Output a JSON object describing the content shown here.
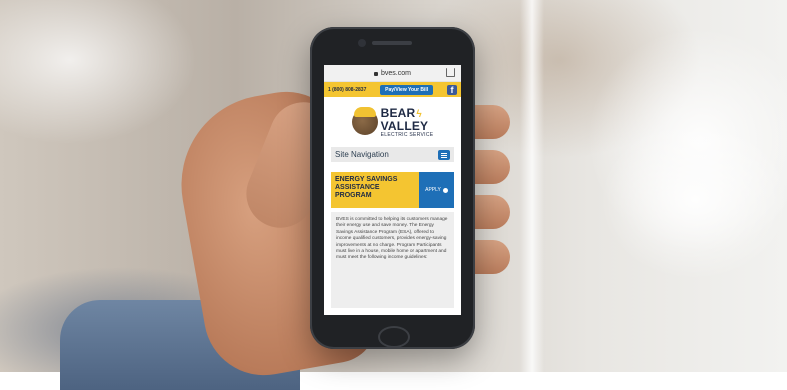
{
  "browser": {
    "url": "bves.com",
    "icons": [
      "lock-icon",
      "share-icon"
    ]
  },
  "topbar": {
    "phone": "1 (800) 808-2837",
    "pay_button": "Pay/View Your Bill",
    "facebook_icon": "f"
  },
  "logo": {
    "line1": "BEAR",
    "line2": "VALLEY",
    "line3": "ELECTRIC SERVICE"
  },
  "navigation": {
    "label": "Site Navigation",
    "menu_icon": "menu-icon"
  },
  "hero": {
    "title": "ENERGY SAVINGS ASSISTANCE PROGRAM",
    "apply": "APPLY"
  },
  "content": {
    "paragraph": "BVES is committed to helping its customers manage their energy use and save money. The Energy Savings Assistance Program (ESA), offered to income qualified customers, provides energy-saving improvements at no charge. Program Participants must live in a house, mobile home or apartment and must meet the following income guidelines:"
  },
  "colors": {
    "brand_yellow": "#f4c531",
    "brand_blue": "#1e6fb7",
    "navy": "#1f2a44"
  }
}
